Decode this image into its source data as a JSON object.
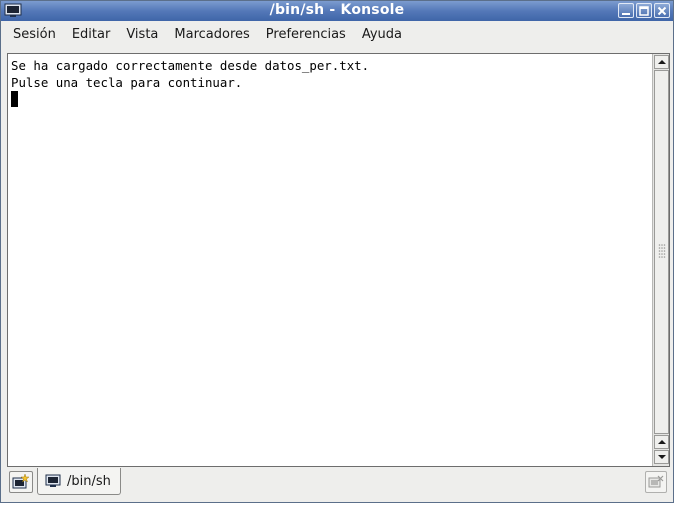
{
  "window": {
    "title": "/bin/sh - Konsole"
  },
  "menubar": {
    "items": [
      {
        "label": "Sesión"
      },
      {
        "label": "Editar"
      },
      {
        "label": "Vista"
      },
      {
        "label": "Marcadores"
      },
      {
        "label": "Preferencias"
      },
      {
        "label": "Ayuda"
      }
    ]
  },
  "terminal": {
    "lines": [
      "Se ha cargado correctamente desde datos_per.txt.",
      "Pulse una tecla para continuar."
    ]
  },
  "tabs": [
    {
      "label": "/bin/sh",
      "icon": "terminal-icon"
    }
  ],
  "colors": {
    "titlebar": "#5478b8",
    "background": "#eeeeec",
    "terminal_bg": "#ffffff",
    "terminal_fg": "#000000"
  }
}
